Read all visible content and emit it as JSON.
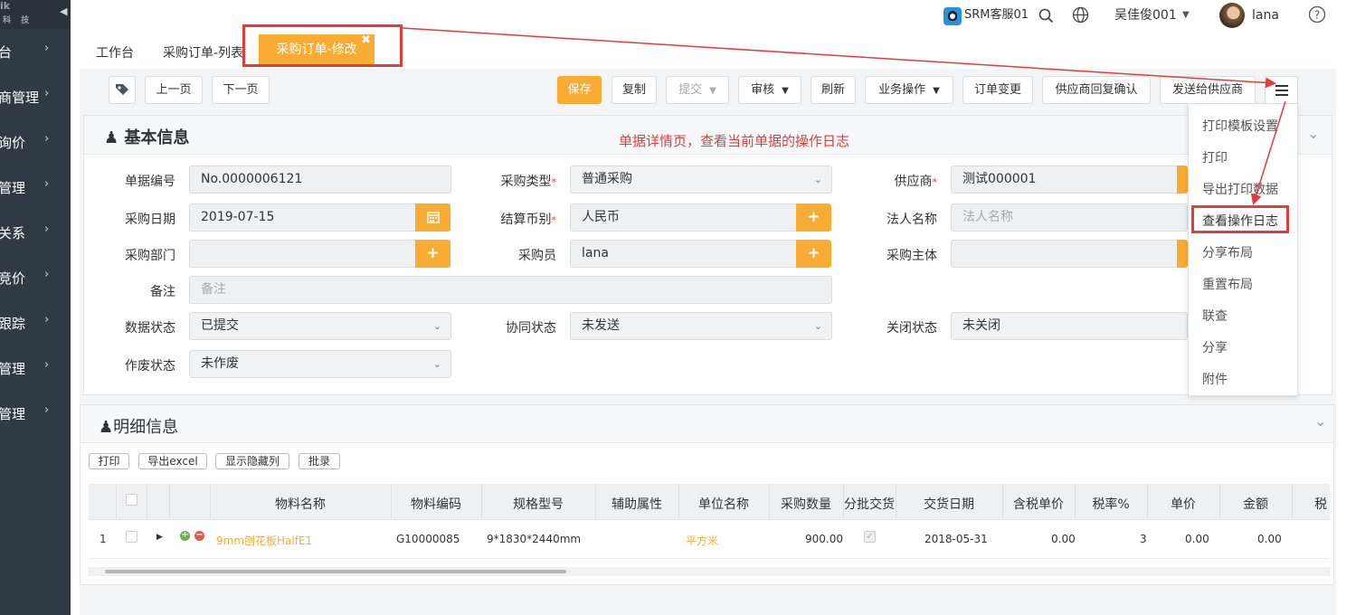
{
  "sidebar": {
    "logo_text": "ik",
    "logo_sub": "科 技",
    "items": [
      {
        "label": "台"
      },
      {
        "label": "商管理"
      },
      {
        "label": "询价"
      },
      {
        "label": "管理"
      },
      {
        "label": "关系"
      },
      {
        "label": "竞价"
      },
      {
        "label": "跟踪"
      },
      {
        "label": "管理"
      },
      {
        "label": "管理"
      }
    ]
  },
  "topbar": {
    "service_label": "SRM客服01",
    "user_name": "吴佳俊001",
    "account_name": "lana"
  },
  "tabs": {
    "workbench": "工作台",
    "list": "采购订单-列表",
    "active": "采购订单-修改"
  },
  "toolbar": {
    "prev": "上一页",
    "next": "下一页",
    "save": "保存",
    "copy": "复制",
    "submit": "提交",
    "audit": "审核",
    "refresh": "刷新",
    "business": "业务操作",
    "order_change": "订单变更",
    "supplier_confirm": "供应商回复确认",
    "send_supplier": "发送给供应商"
  },
  "annotation": "单据详情页，查看当前单据的操作日志",
  "basic": {
    "title": "基本信息",
    "doc_no_label": "单据编号",
    "doc_no": "No.0000006121",
    "purchase_type_label": "采购类型",
    "purchase_type": "普通采购",
    "supplier_label": "供应商",
    "supplier": "测试000001",
    "purchase_date_label": "采购日期",
    "purchase_date": "2019-07-15",
    "currency_label": "结算币别",
    "currency": "人民币",
    "legal_label": "法人名称",
    "legal_placeholder": "法人名称",
    "dept_label": "采购部门",
    "buyer_label": "采购员",
    "buyer": "lana",
    "entity_label": "采购主体",
    "remark_label": "备注",
    "remark_placeholder": "备注",
    "data_status_label": "数据状态",
    "data_status": "已提交",
    "coop_status_label": "协同状态",
    "coop_status": "未发送",
    "close_status_label": "关闭状态",
    "close_status": "未关闭",
    "void_status_label": "作废状态",
    "void_status": "未作废"
  },
  "detail": {
    "title": "明细信息",
    "buttons": {
      "print": "打印",
      "export": "导出excel",
      "show_hidden": "显示隐藏列",
      "batch": "批录"
    },
    "columns": [
      "物料名称",
      "物料编码",
      "规格型号",
      "辅助属性",
      "单位名称",
      "采购数量",
      "分批交货",
      "交货日期",
      "含税单价",
      "税率%",
      "单价",
      "金额",
      "税"
    ],
    "rows": [
      {
        "index": "1",
        "name": "9mm刨花板HalfE1",
        "code": "G10000085",
        "spec": "9*1830*2440mm",
        "aux": "",
        "unit": "平方米",
        "qty": "900.00",
        "date": "2018-05-31",
        "tax_price": "0.00",
        "tax_rate": "3",
        "price": "0.00",
        "amount": "0.00"
      }
    ]
  },
  "menu": {
    "items": [
      "打印模板设置",
      "打印",
      "导出打印数据",
      "查看操作日志",
      "分享布局",
      "重置布局",
      "联查",
      "分享",
      "附件"
    ]
  },
  "colors": {
    "accent": "#f9ac33",
    "sidebar": "#2f3a45",
    "annotation": "#e63b3b"
  }
}
